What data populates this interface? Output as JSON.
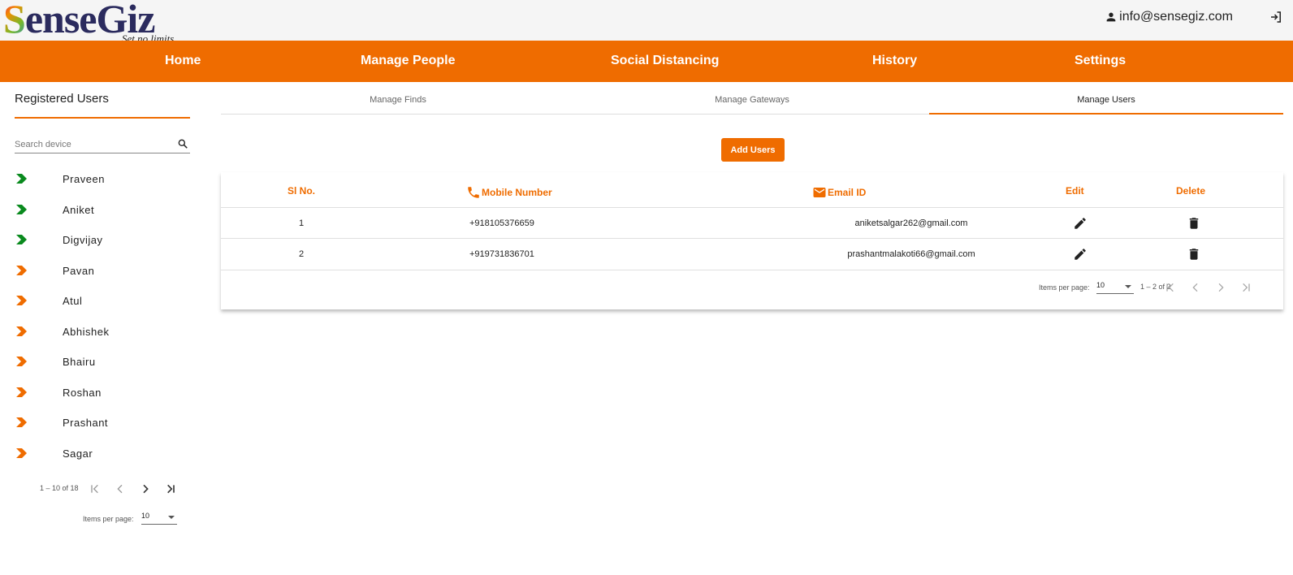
{
  "header": {
    "logo_text": "SenseGiz",
    "logo_tagline": "Set no limits",
    "user_email": "info@sensegiz.com"
  },
  "nav": [
    "Home",
    "Manage People",
    "Social Distancing",
    "History",
    "Settings"
  ],
  "sidebar": {
    "title": "Registered Users",
    "search_placeholder": "Search device",
    "users": [
      {
        "name": "Praveen",
        "status": "green"
      },
      {
        "name": "Aniket",
        "status": "green"
      },
      {
        "name": "Digvijay",
        "status": "green"
      },
      {
        "name": "Pavan",
        "status": "orange"
      },
      {
        "name": "Atul",
        "status": "orange"
      },
      {
        "name": "Abhishek",
        "status": "orange"
      },
      {
        "name": "Bhairu",
        "status": "orange"
      },
      {
        "name": "Roshan",
        "status": "orange"
      },
      {
        "name": "Prashant",
        "status": "orange"
      },
      {
        "name": "Sagar",
        "status": "orange"
      }
    ],
    "range": "1 – 10 of 18",
    "items_per_page_label": "Items per page:",
    "items_per_page": "10"
  },
  "tabs": [
    {
      "label": "Manage Finds",
      "active": false
    },
    {
      "label": "Manage Gateways",
      "active": false
    },
    {
      "label": "Manage Users",
      "active": true
    }
  ],
  "add_button": "Add Users",
  "table": {
    "headers": {
      "sl": "Sl No.",
      "mobile": "Mobile Number",
      "email": "Email ID",
      "edit": "Edit",
      "delete": "Delete"
    },
    "rows": [
      {
        "sl": "1",
        "mobile": "+918105376659",
        "email": "aniketsalgar262@gmail.com"
      },
      {
        "sl": "2",
        "mobile": "+919731836701",
        "email": "prashantmalakoti66@gmail.com"
      }
    ],
    "items_per_page_label": "Items per page:",
    "items_per_page": "10",
    "range": "1 – 2 of 2"
  },
  "colors": {
    "accent": "#ef6c00",
    "status_green": "#0a8a1e",
    "status_orange": "#ef6c00"
  }
}
